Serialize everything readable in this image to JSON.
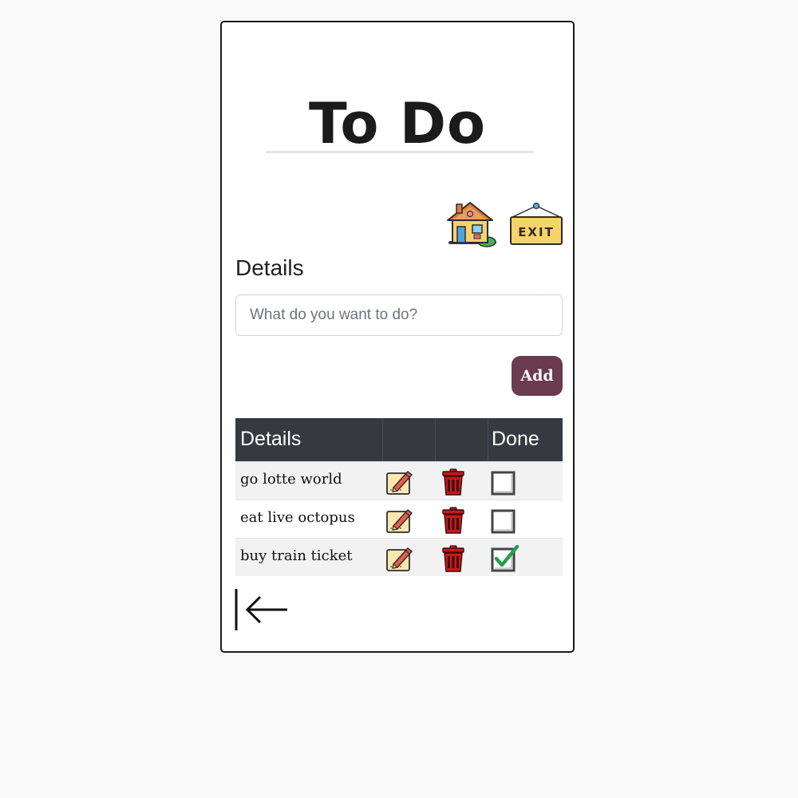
{
  "app": {
    "title": "To Do"
  },
  "nav": {
    "home_icon": "house-icon",
    "exit_icon": "exit-sign-icon",
    "exit_label": "EXIT",
    "back_icon": "arrow-left-bar-icon"
  },
  "form": {
    "label": "Details",
    "placeholder": "What do you want to do?",
    "value": "",
    "add_label": "Add"
  },
  "table": {
    "headers": [
      "Details",
      "",
      "",
      "Done"
    ],
    "rows": [
      {
        "text": "go lotte world",
        "done": false
      },
      {
        "text": "eat live octopus",
        "done": false
      },
      {
        "text": "buy train ticket",
        "done": true
      }
    ]
  },
  "colors": {
    "add_button": "#6b3b4f",
    "header_bg": "#343a40",
    "trash": "#c8191c",
    "check": "#1fa04a"
  }
}
